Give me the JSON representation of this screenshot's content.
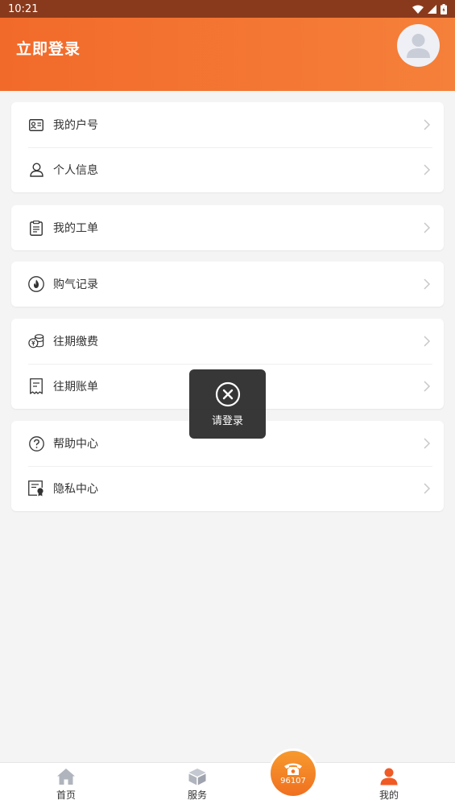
{
  "status_bar": {
    "time": "10:21"
  },
  "header": {
    "login_label": "立即登录"
  },
  "menu": {
    "group1": [
      {
        "label": "我的户号",
        "icon": "id-card-icon"
      },
      {
        "label": "个人信息",
        "icon": "person-icon"
      }
    ],
    "group2": [
      {
        "label": "我的工单",
        "icon": "clipboard-icon"
      }
    ],
    "group3": [
      {
        "label": "购气记录",
        "icon": "flame-icon"
      }
    ],
    "group4": [
      {
        "label": "往期缴费",
        "icon": "coins-icon"
      },
      {
        "label": "往期账单",
        "icon": "receipt-icon"
      }
    ],
    "group5": [
      {
        "label": "帮助中心",
        "icon": "question-icon"
      },
      {
        "label": "隐私中心",
        "icon": "privacy-certificate-icon"
      }
    ]
  },
  "toast": {
    "text": "请登录"
  },
  "tabbar": {
    "home": "首页",
    "service": "服务",
    "hotline": "96107",
    "mine": "我的"
  },
  "colors": {
    "accent": "#f26a2a",
    "status_bar": "#8a3a1c",
    "active_tab": "#f05a24"
  }
}
